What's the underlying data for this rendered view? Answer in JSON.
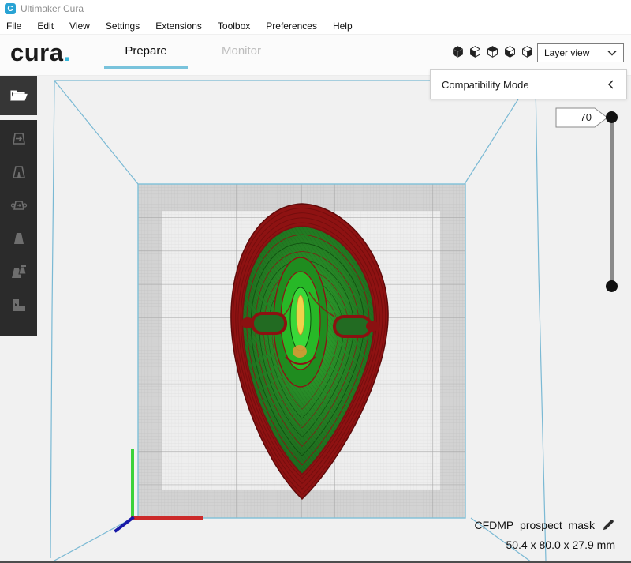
{
  "titlebar": {
    "logo_letter": "C",
    "app_title": "Ultimaker Cura"
  },
  "menubar": {
    "items": [
      "File",
      "Edit",
      "View",
      "Settings",
      "Extensions",
      "Toolbox",
      "Preferences",
      "Help"
    ]
  },
  "header": {
    "logo_text": "cura",
    "logo_dot": ".",
    "tabs": [
      {
        "label": "Prepare"
      },
      {
        "label": "Monitor"
      }
    ],
    "camera_views": [
      "3d-view",
      "front-view",
      "top-view",
      "left-view",
      "right-view"
    ],
    "view_mode": {
      "value": "Layer view"
    }
  },
  "compatibility_panel": {
    "title": "Compatibility Mode"
  },
  "toolbar": {
    "tools": [
      "open-file",
      "move",
      "scale",
      "rotate",
      "mirror",
      "per-model-settings",
      "support-blocker"
    ]
  },
  "layer_slider": {
    "value": "70"
  },
  "model_info": {
    "name": "CFDMP_prospect_mask",
    "dimensions": "50.4 x 80.0 x 27.9 mm"
  },
  "colors": {
    "accent_blue": "#36b6d9",
    "tab_underline": "#79c3dc",
    "build_volume_line": "#7ab9d4",
    "axis_x_red": "#cc2a2a",
    "axis_y_green": "#3bd23b",
    "axis_z_blue": "#1a1aa8",
    "layer_shell_red": "#8e1212",
    "layer_infill_green": "#226e22",
    "layer_bright_green": "#39d839",
    "layer_core_yellow": "#f0d24a"
  }
}
